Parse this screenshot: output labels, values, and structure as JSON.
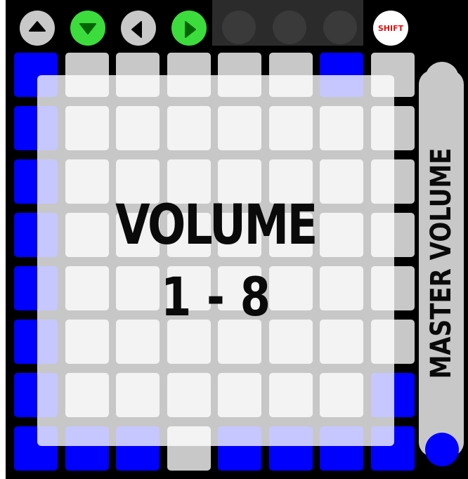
{
  "top_buttons": [
    {
      "name": "up-arrow-button",
      "icon": "triangle-up-icon",
      "color": "#c8c8c8",
      "arrow_color": "#000000"
    },
    {
      "name": "down-arrow-button",
      "icon": "triangle-down-icon",
      "color": "#3cdc3c",
      "arrow_color": "#006400"
    },
    {
      "name": "left-arrow-button",
      "icon": "triangle-left-icon",
      "color": "#c8c8c8",
      "arrow_color": "#000000"
    },
    {
      "name": "right-arrow-button",
      "icon": "triangle-right-icon",
      "color": "#3cdc3c",
      "arrow_color": "#006400"
    }
  ],
  "shift_label": "SHIFT",
  "colors": {
    "active": "#0000ff",
    "inactive": "#c8c8c8",
    "shift_text": "#e01010"
  },
  "grid": [
    [
      "b",
      "g",
      "g",
      "g",
      "g",
      "g",
      "b",
      "g"
    ],
    [
      "b",
      "g",
      "g",
      "g",
      "g",
      "g",
      "g",
      "g"
    ],
    [
      "b",
      "g",
      "g",
      "g",
      "g",
      "g",
      "g",
      "g"
    ],
    [
      "b",
      "g",
      "g",
      "g",
      "g",
      "g",
      "g",
      "g"
    ],
    [
      "b",
      "g",
      "g",
      "g",
      "g",
      "g",
      "g",
      "g"
    ],
    [
      "b",
      "g",
      "g",
      "g",
      "g",
      "g",
      "g",
      "g"
    ],
    [
      "b",
      "g",
      "g",
      "g",
      "g",
      "g",
      "g",
      "b"
    ],
    [
      "b",
      "b",
      "b",
      "g",
      "b",
      "b",
      "b",
      "b"
    ]
  ],
  "overlay": {
    "title": "VOLUME",
    "range": "1 - 8"
  },
  "master": {
    "label": "MASTER VOLUME",
    "knobs": [
      "g",
      "g",
      "g",
      "g",
      "g",
      "g",
      "g",
      "b"
    ]
  }
}
